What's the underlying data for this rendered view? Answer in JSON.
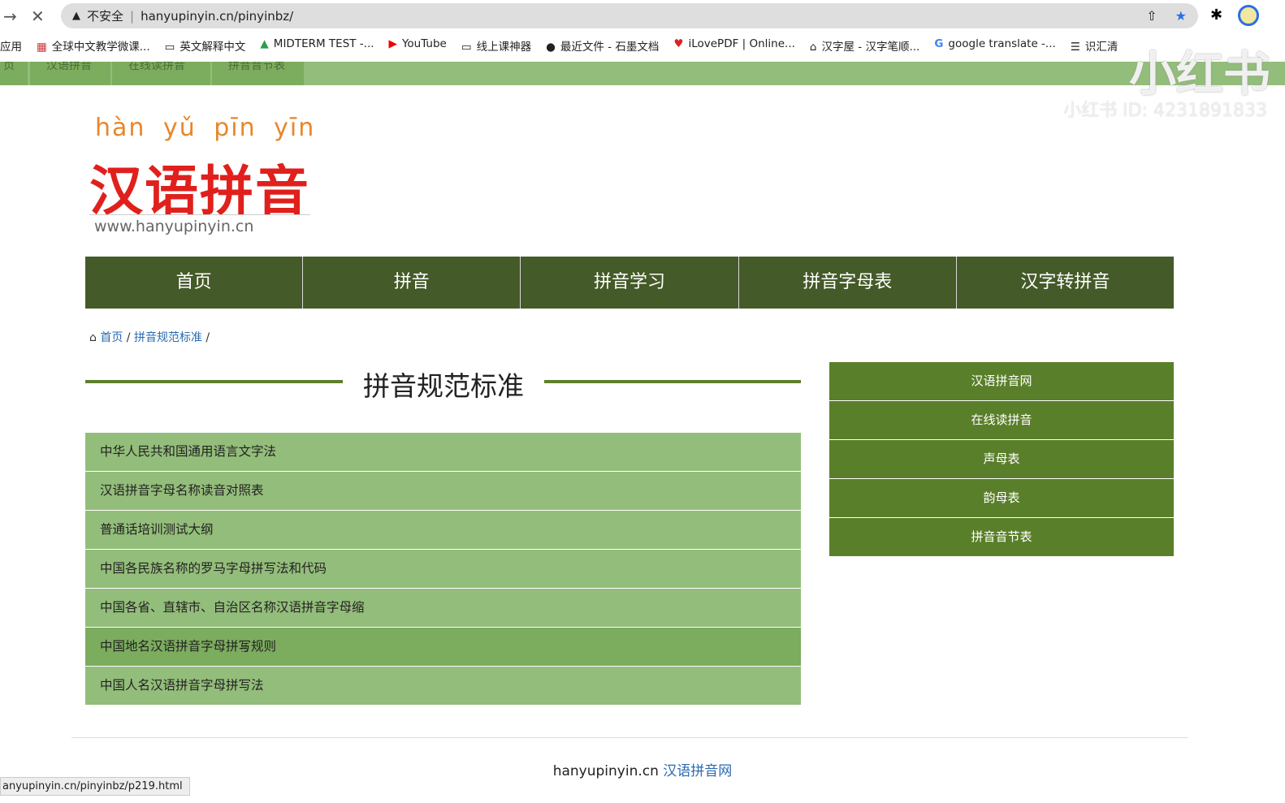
{
  "browser": {
    "url_warning": "不安全",
    "url": "hanyupinyin.cn/pinyinbz/",
    "bookmarks": [
      "应用",
      "全球中文教学微课...",
      "英文解释中文",
      "MIDTERM TEST -...",
      "YouTube",
      "线上课神器",
      "最近文件 - 石墨文档",
      "iLovePDF | Online...",
      "汉字屋 - 汉字笔顺...",
      "google translate -...",
      "识汇清"
    ],
    "status_url": "anyupinyin.cn/pinyinbz/p219.html"
  },
  "sticky_nav": [
    "页",
    "汉语拼音",
    "在线读拼音",
    "拼音音节表"
  ],
  "logo": {
    "pinyin": "hàn yǔ pīn yīn",
    "chinese": "汉语拼音",
    "url": "www.hanyupinyin.cn"
  },
  "main_nav": [
    "首页",
    "拼音",
    "拼音学习",
    "拼音字母表",
    "汉字转拼音"
  ],
  "breadcrumb": {
    "home": "首页",
    "current": "拼音规范标准",
    "sep": "/"
  },
  "page_title": "拼音规范标准",
  "list": [
    "中华人民共和国通用语言文字法",
    "汉语拼音字母名称读音对照表",
    "普通话培训测试大纲",
    "中国各民族名称的罗马字母拼写法和代码",
    "中国各省、直辖市、自治区名称汉语拼音字母缩",
    "中国地名汉语拼音字母拼写规则",
    "中国人名汉语拼音字母拼写法"
  ],
  "sidebar": [
    "汉语拼音网",
    "在线读拼音",
    "声母表",
    "韵母表",
    "拼音音节表"
  ],
  "footer": {
    "domain": "hanyupinyin.cn",
    "link": "汉语拼音网"
  },
  "watermark": {
    "logo": "小红书",
    "id": "小红书 ID: 4231891833"
  },
  "colors": {
    "nav": "#445a28",
    "list": "#93bd7a",
    "list_hover": "#7cac5e",
    "sidebar": "#5a7f2a",
    "logo_red": "#e0201c",
    "logo_orange": "#e8862a"
  }
}
